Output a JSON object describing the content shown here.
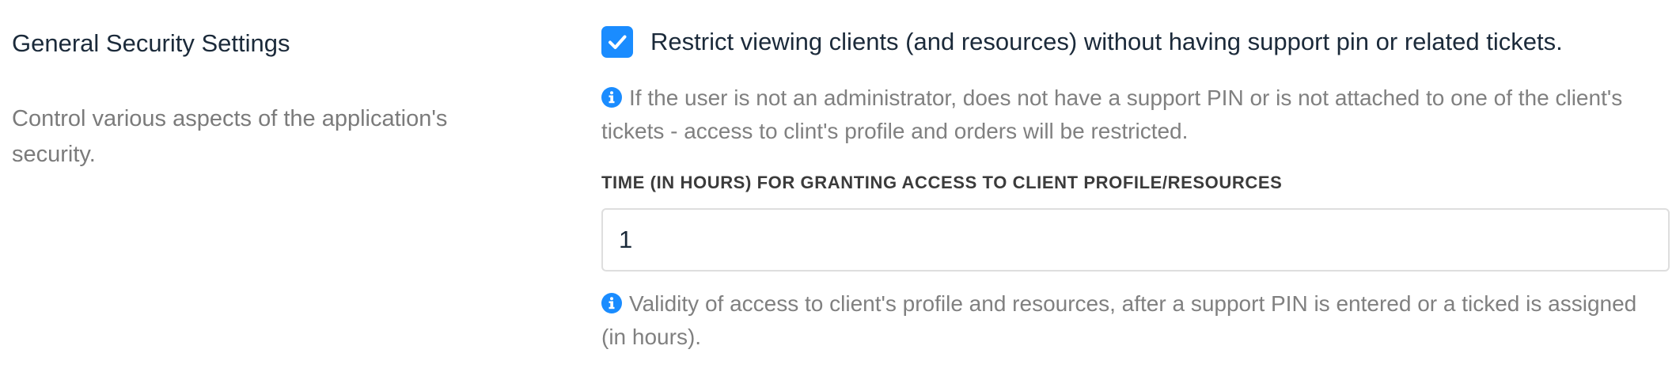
{
  "section": {
    "title": "General Security Settings",
    "description": "Control various aspects of the application's security."
  },
  "restrict_viewing": {
    "checked": true,
    "label": "Restrict viewing clients (and resources) without having support pin or related tickets.",
    "help": "If the user is not an administrator, does not have a support PIN or is not attached to one of the client's tickets - access to clint's profile and orders will be restricted."
  },
  "access_time": {
    "label": "TIME (IN HOURS) FOR GRANTING ACCESS TO CLIENT PROFILE/RESOURCES",
    "value": "1",
    "help": "Validity of access to client's profile and resources, after a support PIN is entered or a ticked is assigned (in hours)."
  },
  "icons": {
    "checkbox": "checkmark-icon",
    "help": "info-circle-icon"
  },
  "colors": {
    "accent": "#1a8cff",
    "muted_text": "#808080",
    "heading_text": "#1b2a3a",
    "input_border": "#dedede"
  }
}
